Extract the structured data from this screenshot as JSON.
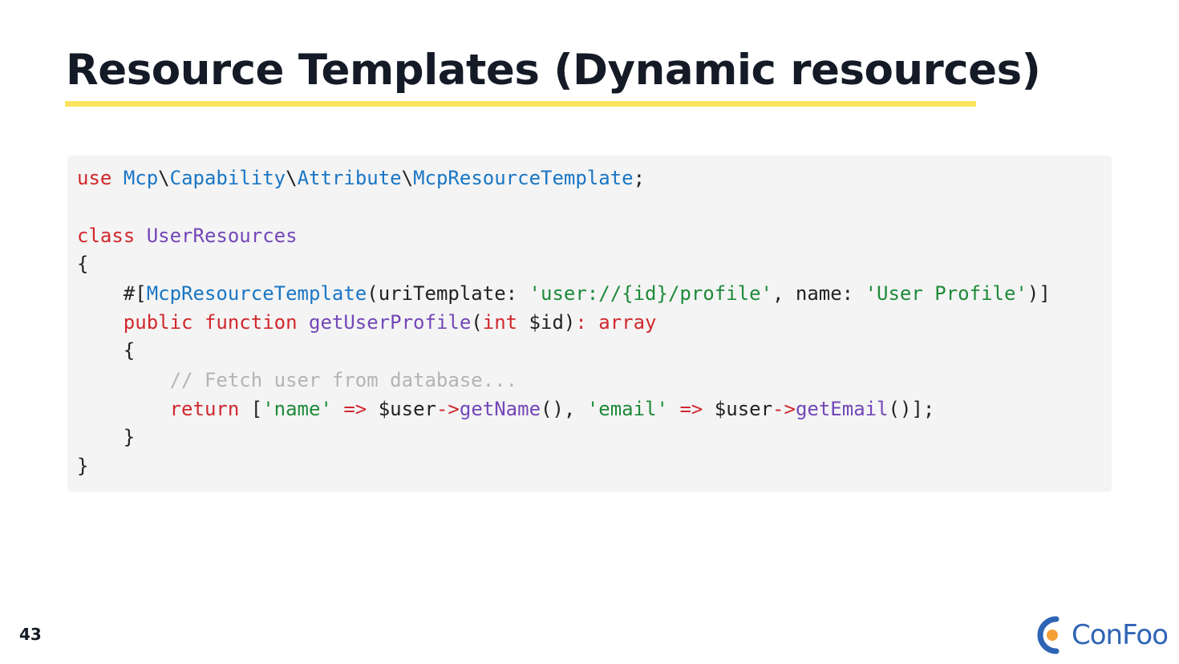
{
  "slide": {
    "title": "Resource Templates (Dynamic resources)",
    "page_number": "43",
    "logo_text": "ConFoo",
    "accent_color": "#fbe35f"
  },
  "code": {
    "language": "php",
    "line1": {
      "t1": "use",
      "t2": " ",
      "t3": "Mcp",
      "t4": "\\",
      "t5": "Capability",
      "t6": "\\",
      "t7": "Attribute",
      "t8": "\\",
      "t9": "McpResourceTemplate",
      "t10": ";"
    },
    "line2": {
      "t1": "class",
      "t2": " ",
      "t3": "UserResources"
    },
    "line3": {
      "t1": "{"
    },
    "line4": {
      "t1": "    #[",
      "t2": "McpResourceTemplate",
      "t3": "(uriTemplate: ",
      "t4": "'user://{id}/profile'",
      "t5": ", name: ",
      "t6": "'User Profile'",
      "t7": ")]"
    },
    "line5": {
      "t1": "    ",
      "t2": "public",
      "t3": " ",
      "t4": "function",
      "t5": " ",
      "t6": "getUserProfile",
      "t7": "(",
      "t8": "int",
      "t9": " $id)",
      "t10": ": array"
    },
    "line6": {
      "t1": "    {"
    },
    "line7": {
      "t1": "        ",
      "t2": "// Fetch user from database..."
    },
    "line8": {
      "t1": "        ",
      "t2": "return",
      "t3": " [",
      "t4": "'name'",
      "t5": " ",
      "t6": "=>",
      "t7": " $user",
      "t8": "->",
      "t9": "getName",
      "t10": "(), ",
      "t11": "'email'",
      "t12": " ",
      "t13": "=>",
      "t14": " $user",
      "t15": "->",
      "t16": "getEmail",
      "t17": "()];"
    },
    "line9": {
      "t1": "    }"
    },
    "line10": {
      "t1": "}"
    }
  }
}
